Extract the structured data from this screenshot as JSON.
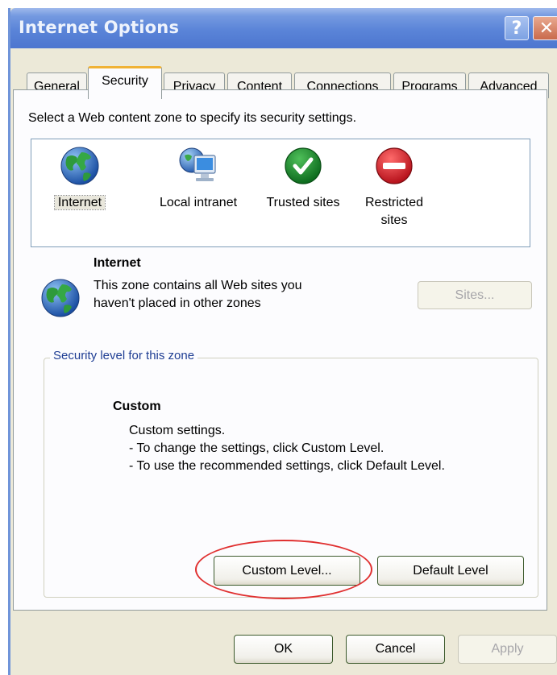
{
  "window": {
    "title": "Internet Options",
    "help_label": "?",
    "close_label": "✕"
  },
  "tabs": [
    {
      "label": "General",
      "active": false
    },
    {
      "label": "Security",
      "active": true
    },
    {
      "label": "Privacy",
      "active": false
    },
    {
      "label": "Content",
      "active": false
    },
    {
      "label": "Connections",
      "active": false
    },
    {
      "label": "Programs",
      "active": false
    },
    {
      "label": "Advanced",
      "active": false
    }
  ],
  "security": {
    "instruction": "Select a Web content zone to specify its security settings.",
    "zones": [
      {
        "label": "Internet",
        "icon": "globe-icon",
        "selected": true
      },
      {
        "label": "Local intranet",
        "icon": "computer-globe-icon",
        "selected": false
      },
      {
        "label": "Trusted sites",
        "icon": "checkmark-icon",
        "selected": false
      },
      {
        "label": "Restricted sites",
        "icon": "no-entry-icon",
        "selected": false
      }
    ],
    "selected_zone": {
      "name": "Internet",
      "desc_line1": "This zone contains all Web sites you",
      "desc_line2": "haven't placed in other zones"
    },
    "sites_button": "Sites...",
    "level_group": {
      "label": "Security level for this zone",
      "level_name": "Custom",
      "lines": [
        "Custom settings.",
        "- To change the settings, click Custom Level.",
        "- To use the recommended settings, click Default Level."
      ],
      "custom_level_button": "Custom Level...",
      "default_level_button": "Default Level"
    }
  },
  "footer": {
    "ok": "OK",
    "cancel": "Cancel",
    "apply": "Apply"
  },
  "colors": {
    "titlebar": "#5a84d8",
    "active_tab_accent": "#f0b235",
    "highlight": "#e03030"
  }
}
